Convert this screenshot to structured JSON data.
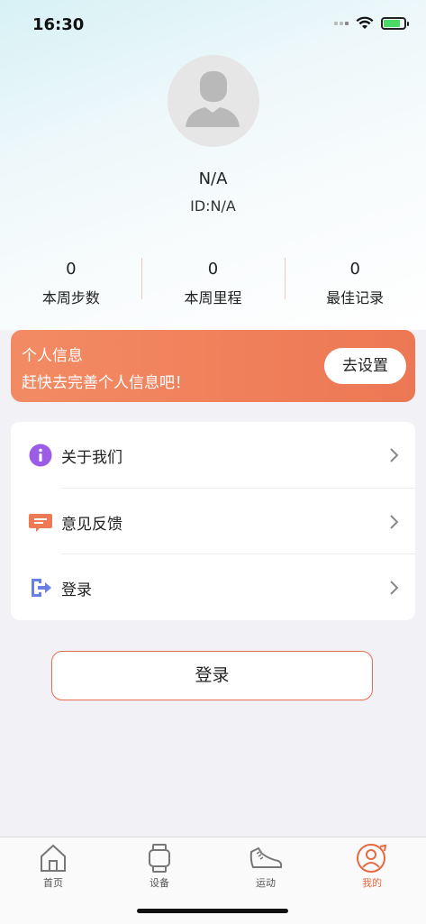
{
  "status_bar": {
    "time": "16:30"
  },
  "profile": {
    "nickname": "N/A",
    "user_id": "ID:N/A"
  },
  "stats": [
    {
      "value": "0",
      "label": "本周步数"
    },
    {
      "value": "0",
      "label": "本周里程"
    },
    {
      "value": "0",
      "label": "最佳记录"
    }
  ],
  "promo": {
    "title": "个人信息",
    "subtitle": "赶快去完善个人信息吧！",
    "button": "去设置"
  },
  "menu": [
    {
      "label": "关于我们",
      "icon": "info-icon",
      "color": "#9b5de5"
    },
    {
      "label": "意见反馈",
      "icon": "feedback-icon",
      "color": "#ee7a55"
    },
    {
      "label": "登录",
      "icon": "login-icon",
      "color": "#6a7ee6"
    }
  ],
  "login_button": "登录",
  "tabs": [
    {
      "label": "首页",
      "icon": "home-icon",
      "active": false
    },
    {
      "label": "设备",
      "icon": "watch-icon",
      "active": false
    },
    {
      "label": "运动",
      "icon": "shoe-icon",
      "active": false
    },
    {
      "label": "我的",
      "icon": "user-icon",
      "active": true
    }
  ],
  "colors": {
    "accent": "#e8693f",
    "promo_bg": "#ef7e5a"
  }
}
